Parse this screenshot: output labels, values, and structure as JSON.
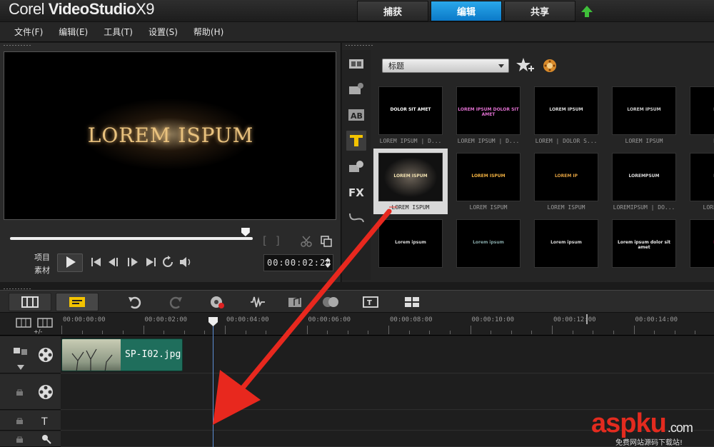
{
  "app": {
    "title_prefix": "Corel ",
    "title_main": "VideoStudio",
    "title_suffix": "X9"
  },
  "tabs": [
    {
      "label": "捕获",
      "active": false
    },
    {
      "label": "编辑",
      "active": true
    },
    {
      "label": "共享",
      "active": false
    }
  ],
  "menu": [
    "文件(F)",
    "编辑(E)",
    "工具(T)",
    "设置(S)",
    "帮助(H)"
  ],
  "preview": {
    "overlay_text": "LOREM ISPUM",
    "scrub_position": 0.97,
    "mode_labels": [
      "项目",
      "素材"
    ],
    "timecode": "00:00:02:24"
  },
  "library": {
    "category": "标题",
    "thumbnails": [
      {
        "text": "DOLOR SIT AMET",
        "caption": "LOREM IPSUM | D..."
      },
      {
        "text": "LOREM IPSUM DOLOR SIT AMET",
        "caption": "LOREM IPSUM | D..."
      },
      {
        "text": "LOREM IPSUM",
        "caption": "LOREM | DOLOR S..."
      },
      {
        "text": "LOREM IPSUM",
        "caption": "LOREM IPSUM"
      },
      {
        "text": "LOREM",
        "caption": "LOREM"
      },
      {
        "text": "LOREM ISPUM",
        "caption": "LOREM ISPUM",
        "selected": true
      },
      {
        "text": "LOREM ISPUM",
        "caption": "LOREM ISPUM"
      },
      {
        "text": "LOREM IP",
        "caption": "LOREM ISPUM"
      },
      {
        "text": "LOREMPSUM",
        "caption": "LOREMIPSUM | DO..."
      },
      {
        "text": "LOREM",
        "caption": "LOREM ISPUM"
      },
      {
        "text": "Lorem ipsum",
        "caption": ""
      },
      {
        "text": "Lorem ipsum",
        "caption": ""
      },
      {
        "text": "Lorem ipsum",
        "caption": ""
      },
      {
        "text": "Lorem ipsum dolor sit amet",
        "caption": ""
      },
      {
        "text": "LOREM",
        "caption": ""
      }
    ]
  },
  "timeline": {
    "ruler_labels": [
      "00:00:00:00",
      "00:00:02:00",
      "00:00:04:00",
      "00:00:06:00",
      "00:00:08:00",
      "00:00:10:00",
      "00:00:12:00",
      "00:00:14:00"
    ],
    "zoom_label": "+/-",
    "clip_name": "SP-I02.jpg"
  },
  "watermark": {
    "brand": "aspku",
    "suffix": ".com",
    "sub": "免费网站源码下载站!"
  },
  "colors": {
    "accent": "#0b79c8",
    "arrow": "#e8281e",
    "clip": "#1f6e5c"
  }
}
